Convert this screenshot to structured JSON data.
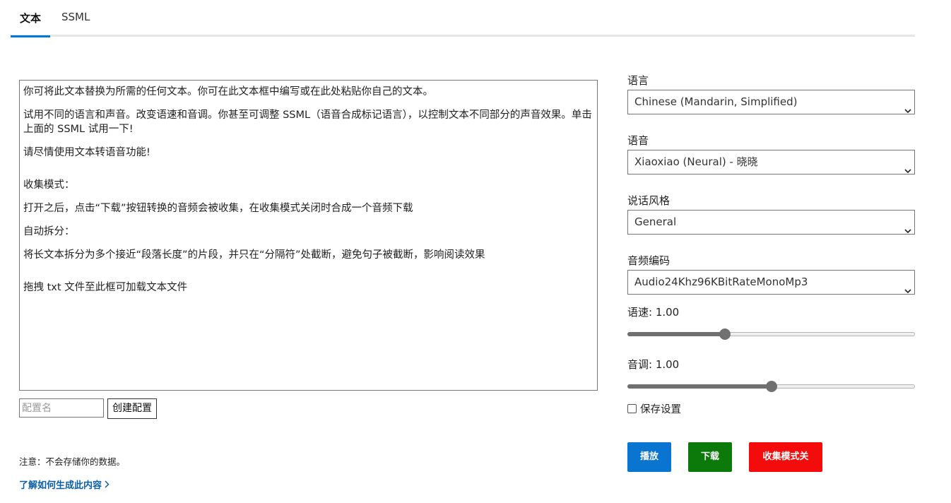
{
  "tabs": [
    {
      "label": "文本",
      "active": true
    },
    {
      "label": "SSML",
      "active": false
    }
  ],
  "editor": {
    "paragraphs": [
      "你可将此文本替换为所需的任何文本。你可在此文本框中编写或在此处粘贴你自己的文本。",
      "试用不同的语言和声音。改变语速和音调。你甚至可调整 SSML（语音合成标记语言），以控制文本不同部分的声音效果。单击上面的 SSML 试用一下!",
      "请尽情使用文本转语音功能!",
      "收集模式：",
      "打开之后，点击“下载”按钮转换的音频会被收集，在收集模式关闭时合成一个音频下载",
      "自动拆分：",
      "将长文本拆分为多个接近“段落长度”的片段，并只在“分隔符”处截断，避免句子被截断，影响阅读效果",
      "拖拽 txt 文件至此框可加载文本文件"
    ]
  },
  "config": {
    "name_placeholder": "配置名",
    "create_label": "创建配置"
  },
  "footer": {
    "notice": "注意：不会存储你的数据。",
    "learn_link": "了解如何生成此内容"
  },
  "settings": {
    "language": {
      "label": "语言",
      "value": "Chinese (Mandarin, Simplified)"
    },
    "voice": {
      "label": "语音",
      "value": "Xiaoxiao (Neural) - 晓晓"
    },
    "style": {
      "label": "说话风格",
      "value": "General"
    },
    "codec": {
      "label": "音频编码",
      "value": "Audio24Khz96KBitRateMonoMp3"
    },
    "rate": {
      "label": "语速: 1.00",
      "fraction": 0.34
    },
    "pitch": {
      "label": "音调: 1.00",
      "fraction": 0.5
    },
    "save_settings": {
      "label": "保存设置",
      "checked": false
    }
  },
  "actions": {
    "play": "播放",
    "download": "下载",
    "collect": "收集模式关"
  },
  "colors": {
    "accent": "#0078d4",
    "play": "#0a74d1",
    "download": "#0b7a0b",
    "collect": "#f40b0b"
  }
}
